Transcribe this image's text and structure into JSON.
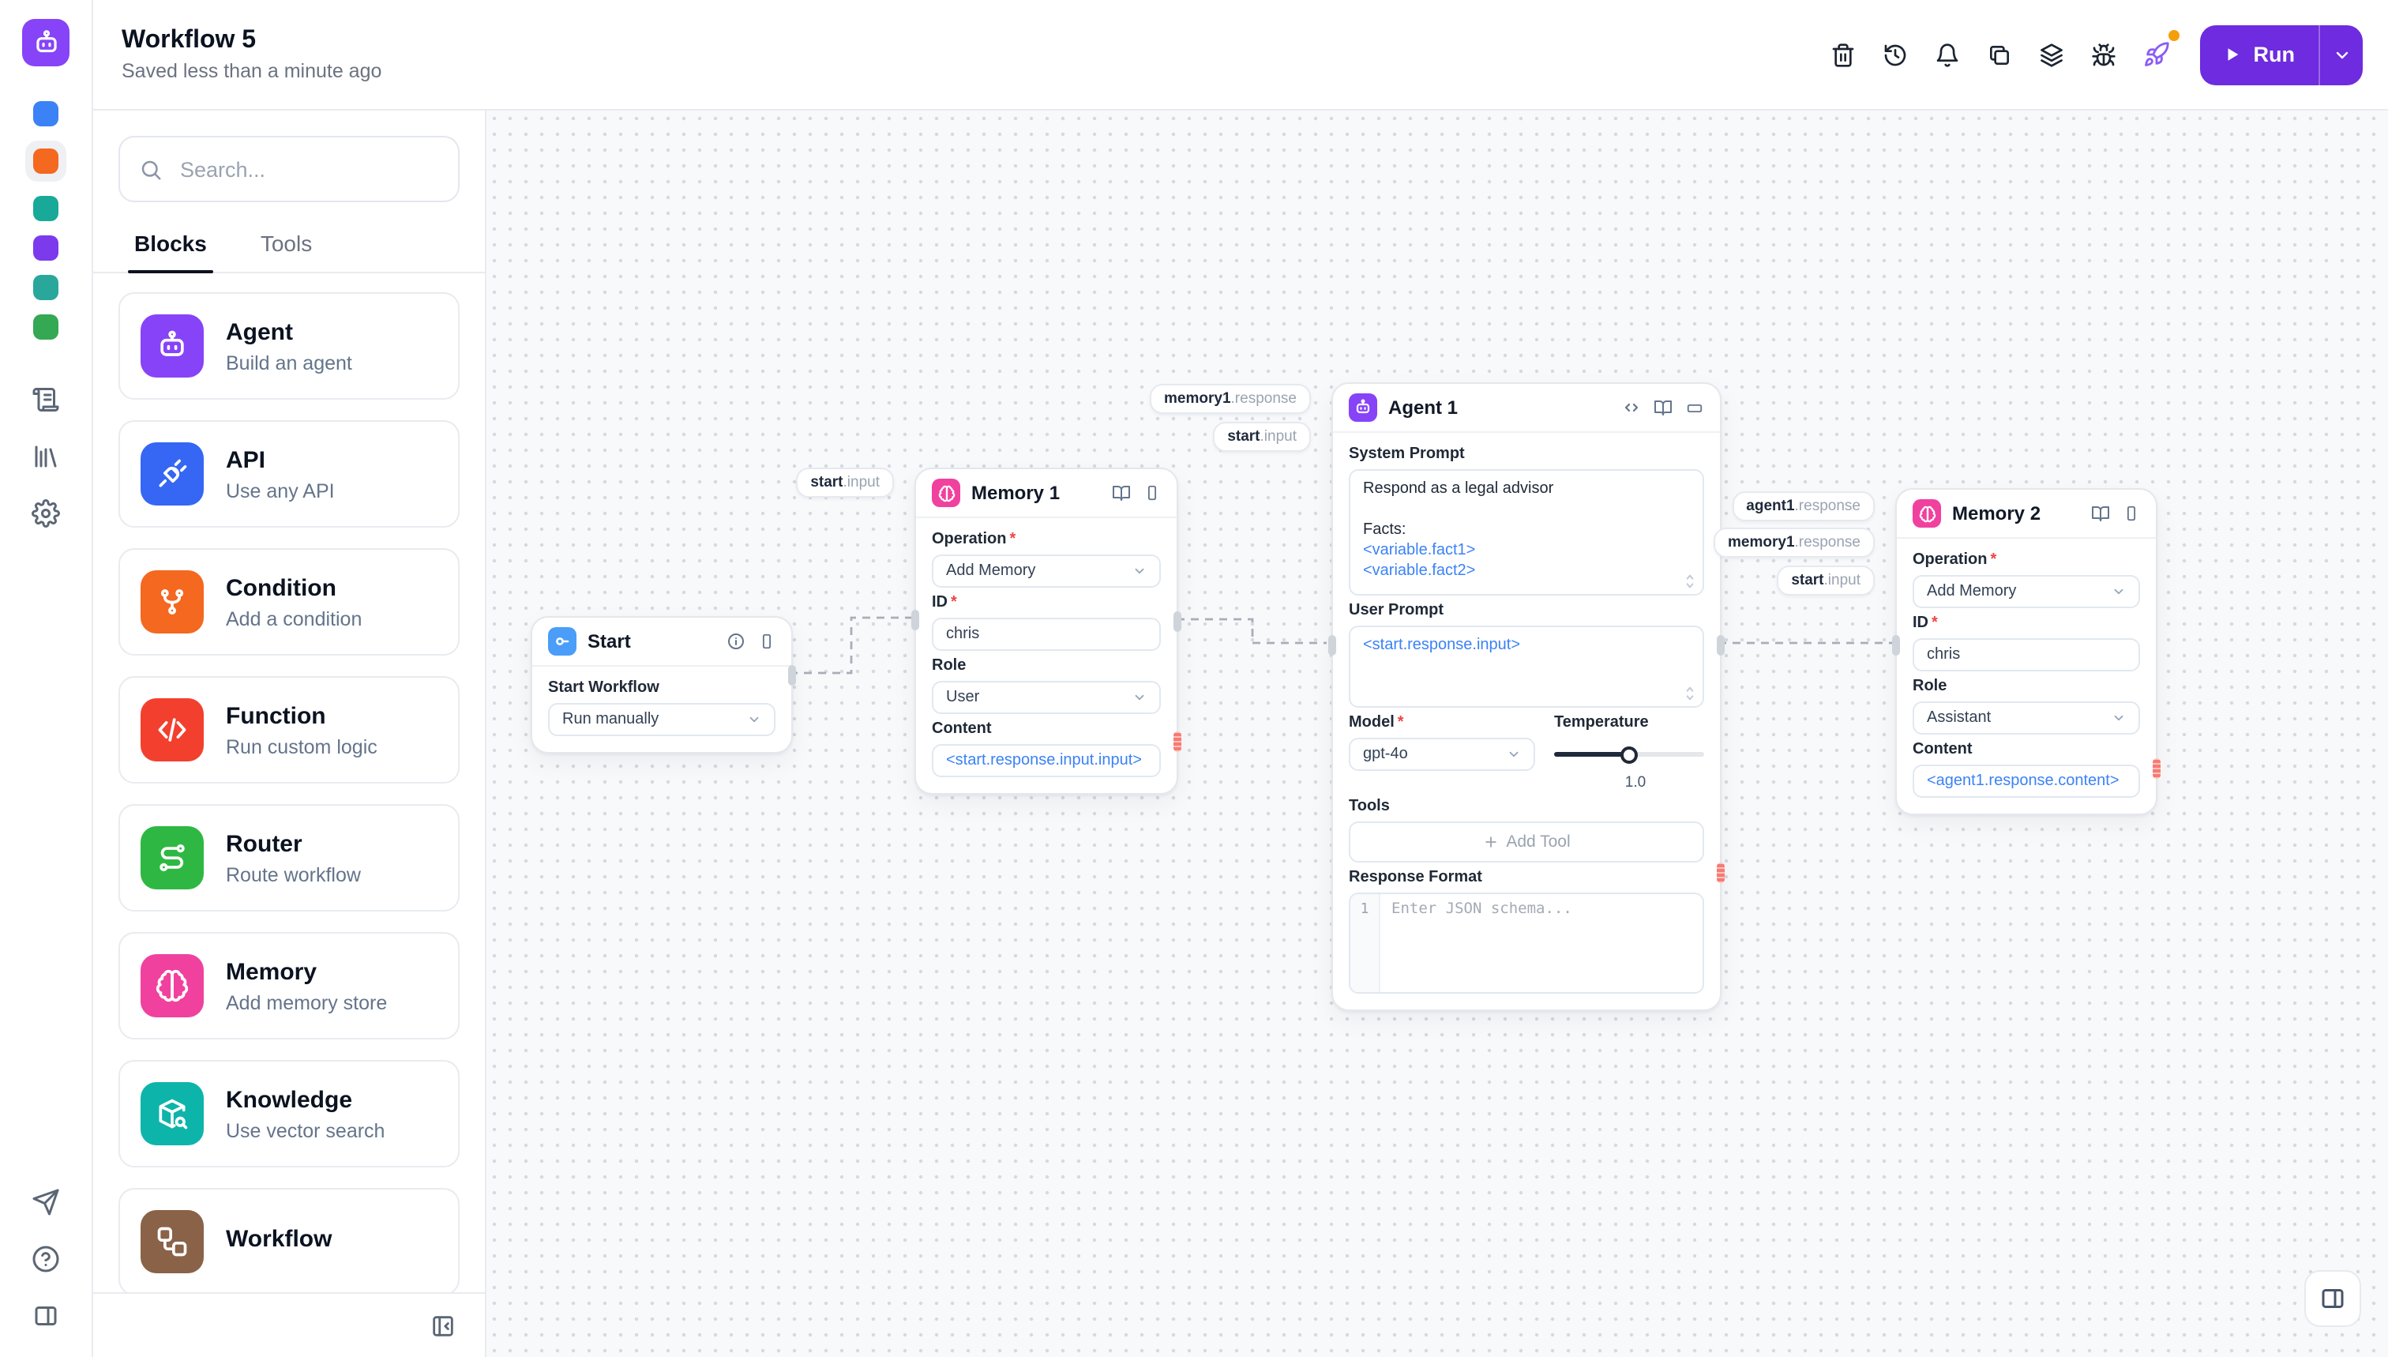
{
  "header": {
    "title": "Workflow 5",
    "saved_status": "Saved less than a minute ago",
    "run_label": "Run"
  },
  "required_marker": "*",
  "sidebar": {
    "search_placeholder": "Search...",
    "tabs": {
      "blocks": "Blocks",
      "tools": "Tools"
    },
    "blocks": [
      {
        "label": "Agent",
        "description": "Build an agent",
        "color": "#8743f7",
        "icon": "robot"
      },
      {
        "label": "API",
        "description": "Use any API",
        "color": "#3566f4",
        "icon": "plug"
      },
      {
        "label": "Condition",
        "description": "Add a condition",
        "color": "#f4681f",
        "icon": "branch"
      },
      {
        "label": "Function",
        "description": "Run custom logic",
        "color": "#f3402e",
        "icon": "code"
      },
      {
        "label": "Router",
        "description": "Route workflow",
        "color": "#2eb843",
        "icon": "route"
      },
      {
        "label": "Memory",
        "description": "Add memory store",
        "color": "#f0419f",
        "icon": "brain"
      },
      {
        "label": "Knowledge",
        "description": "Use vector search",
        "color": "#0db4aa",
        "icon": "box-search"
      },
      {
        "label": "Workflow",
        "description": "",
        "color": "#8a6248",
        "icon": "workflow"
      }
    ]
  },
  "canvas": {
    "start": {
      "title": "Start",
      "workflow_label": "Start Workflow",
      "run_mode": "Run manually"
    },
    "memory1": {
      "title": "Memory 1",
      "operation_label": "Operation",
      "operation": "Add Memory",
      "id_label": "ID",
      "id_value": "chris",
      "role_label": "Role",
      "role": "User",
      "content_label": "Content",
      "content": "<start.response.input.input>"
    },
    "agent1": {
      "title": "Agent 1",
      "system_prompt_label": "System Prompt",
      "sp_line1": "Respond as a legal advisor",
      "sp_line2": "Facts:",
      "sp_var1": "<variable.fact1>",
      "sp_var2": "<variable.fact2>",
      "user_prompt_label": "User Prompt",
      "user_prompt": "<start.response.input>",
      "model_label": "Model",
      "model": "gpt-4o",
      "temperature_label": "Temperature",
      "temperature": "1.0",
      "tools_label": "Tools",
      "add_tool_label": "Add Tool",
      "response_format_label": "Response Format",
      "rf_line_number": "1",
      "rf_placeholder": "Enter JSON schema..."
    },
    "memory2": {
      "title": "Memory 2",
      "operation_label": "Operation",
      "operation": "Add Memory",
      "id_label": "ID",
      "id_value": "chris",
      "role_label": "Role",
      "role": "Assistant",
      "content_label": "Content",
      "content": "<agent1.response.content>"
    },
    "edge_labels": {
      "to_memory1": [
        {
          "strong": "start",
          "rest": ".input"
        }
      ],
      "to_agent1": [
        {
          "strong": "memory1",
          "rest": ".response"
        },
        {
          "strong": "start",
          "rest": ".input"
        }
      ],
      "to_memory2": [
        {
          "strong": "agent1",
          "rest": ".response"
        },
        {
          "strong": "memory1",
          "rest": ".response"
        },
        {
          "strong": "start",
          "rest": ".input"
        }
      ]
    }
  },
  "colors": {
    "run_button": "#6e2bdf",
    "brand_purple": "#8743f7",
    "notification_dot": "#f59e0b",
    "variable_blue": "#3b82f6",
    "error_handle": "#f87a72",
    "workspace_swatches": [
      "#3b82f6",
      "#f4681f",
      "#18a999",
      "#7c3aed",
      "#2aa79b",
      "#34a853"
    ],
    "active_workspace_index": 1
  }
}
